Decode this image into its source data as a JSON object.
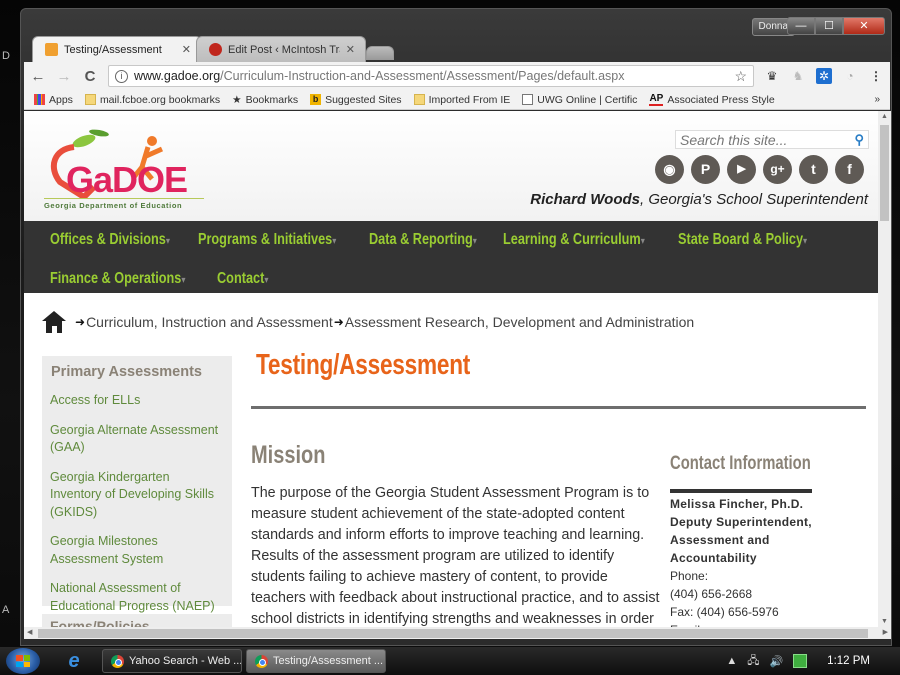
{
  "desktop": {
    "left_labels": [
      "D",
      "A"
    ]
  },
  "window": {
    "profile": "Donna",
    "controls": {
      "minimize": "—",
      "maximize": "☐",
      "close": "✕"
    }
  },
  "tabs": [
    {
      "label": "Testing/Assessment",
      "active": true,
      "favicon_color": "#f0a030"
    },
    {
      "label": "Edit Post ‹ McIntosh Trai",
      "active": false,
      "favicon_color": "#c0261c"
    }
  ],
  "toolbar": {
    "back": "←",
    "forward": "→",
    "reload": "C",
    "url_host": "www.gadoe.org",
    "url_path": "/Curriculum-Instruction-and-Assessment/Assessment/Pages/default.aspx",
    "star": "☆"
  },
  "bookmarks": [
    {
      "label": "Apps",
      "icon": "apps-grid"
    },
    {
      "label": "mail.fcboe.org bookmarks",
      "icon": "folder"
    },
    {
      "label": "Bookmarks",
      "icon": "star"
    },
    {
      "label": "Suggested Sites",
      "icon": "bing"
    },
    {
      "label": "Imported From IE",
      "icon": "folder"
    },
    {
      "label": "UWG Online | Certific",
      "icon": "page"
    },
    {
      "label": "Associated Press Style",
      "icon": "ap-logo"
    }
  ],
  "bookmarks_more": "»",
  "site": {
    "logo_text": "GaDOE",
    "logo_subtitle": "Georgia Department of Education",
    "search_placeholder": "Search this site...",
    "social": [
      {
        "name": "rss",
        "glyph": "◉"
      },
      {
        "name": "pinterest",
        "glyph": "P"
      },
      {
        "name": "youtube",
        "glyph": "▶"
      },
      {
        "name": "google-plus",
        "glyph": "g+"
      },
      {
        "name": "twitter",
        "glyph": "t"
      },
      {
        "name": "facebook",
        "glyph": "f"
      }
    ],
    "tagline_name": "Richard Woods",
    "tagline_rest": ", Georgia's School Superintendent"
  },
  "nav": [
    {
      "label": "Offices & Divisions"
    },
    {
      "label": "Programs & Initiatives"
    },
    {
      "label": "Data & Reporting"
    },
    {
      "label": "Learning & Curriculum"
    },
    {
      "label": "State Board & Policy"
    },
    {
      "label": "Finance & Operations"
    },
    {
      "label": "Contact"
    }
  ],
  "nav_caret": "▾",
  "breadcrumb": {
    "separator": "➜",
    "items": [
      "Curriculum, Instruction and Assessment",
      "Assessment Research, Development and Administration"
    ]
  },
  "sidebar": {
    "heading": "Primary Assessments",
    "links": [
      "Access for ELLs",
      "Georgia Alternate Assessment (GAA)",
      "Georgia Kindergarten Inventory of Developing Skills (GKIDS)",
      "Georgia Milestones Assessment System",
      "National Assessment of Educational Progress (NAEP)"
    ],
    "next_heading_partial": "Forms/Policies"
  },
  "content": {
    "title": "Testing/Assessment",
    "section_heading": "Mission",
    "mission": "The purpose of the Georgia Student Assessment Program is to measure student achievement of the state-adopted content standards and inform efforts to improve teaching and learning. Results of the assessment program are utilized to identify students failing to achieve mastery of content, to provide teachers with feedback about instructional practice, and to assist school districts in identifying strengths and weaknesses in order"
  },
  "contact": {
    "heading": "Contact Information",
    "name": "Melissa Fincher, Ph.D.",
    "title_lines": [
      "Deputy Superintendent,",
      "Assessment and",
      "Accountability"
    ],
    "phone_label": "Phone:",
    "phone": "(404) 656-2668",
    "fax": "Fax: (404) 656-5976",
    "email_label": "Email:"
  },
  "taskbar": {
    "tasks": [
      {
        "label": "Yahoo Search - Web ...",
        "active": false
      },
      {
        "label": "Testing/Assessment ...",
        "active": true
      }
    ],
    "clock": "1:12 PM",
    "tray_up": "▲"
  }
}
